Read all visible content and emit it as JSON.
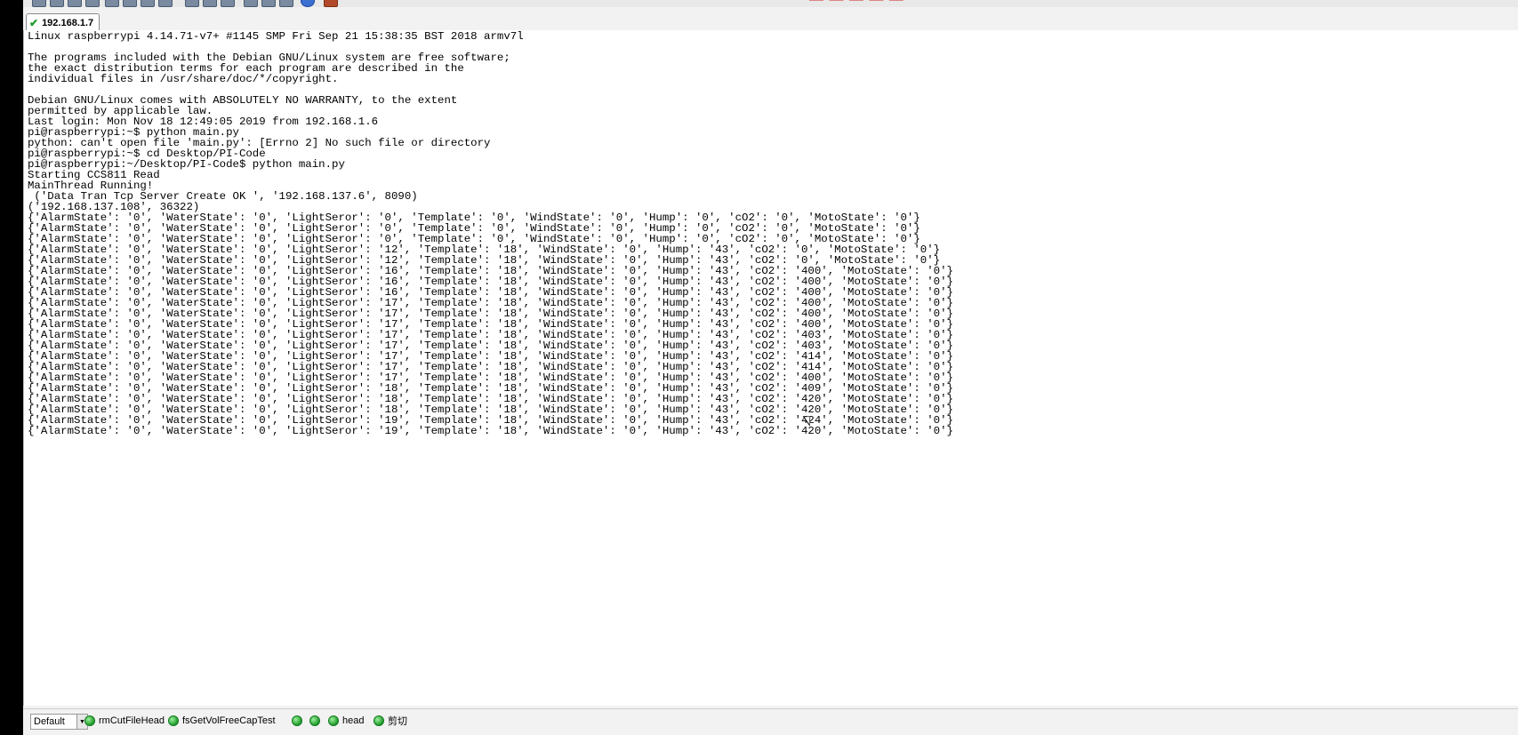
{
  "toolbar": {
    "title_fragment": "— — — — —"
  },
  "tab": {
    "label": "192.168.1.7",
    "icon": "check-icon"
  },
  "terminal": {
    "lines": [
      "Linux raspberrypi 4.14.71-v7+ #1145 SMP Fri Sep 21 15:38:35 BST 2018 armv7l",
      "",
      "The programs included with the Debian GNU/Linux system are free software;",
      "the exact distribution terms for each program are described in the",
      "individual files in /usr/share/doc/*/copyright.",
      "",
      "Debian GNU/Linux comes with ABSOLUTELY NO WARRANTY, to the extent",
      "permitted by applicable law.",
      "Last login: Mon Nov 18 12:49:05 2019 from 192.168.1.6",
      "pi@raspberrypi:~$ python main.py",
      "python: can't open file 'main.py': [Errno 2] No such file or directory",
      "pi@raspberrypi:~$ cd Desktop/PI-Code",
      "pi@raspberrypi:~/Desktop/PI-Code$ python main.py",
      "Starting CCS811 Read",
      "MainThread Running!",
      " ('Data Tran Tcp Server Create OK ', '192.168.137.6', 8090)",
      "('192.168.137.108', 36322)",
      "{'AlarmState': '0', 'WaterState': '0', 'LightSeror': '0', 'Template': '0', 'WindState': '0', 'Hump': '0', 'cO2': '0', 'MotoState': '0'}",
      "{'AlarmState': '0', 'WaterState': '0', 'LightSeror': '0', 'Template': '0', 'WindState': '0', 'Hump': '0', 'cO2': '0', 'MotoState': '0'}",
      "{'AlarmState': '0', 'WaterState': '0', 'LightSeror': '0', 'Template': '0', 'WindState': '0', 'Hump': '0', 'cO2': '0', 'MotoState': '0'}",
      "{'AlarmState': '0', 'WaterState': '0', 'LightSeror': '12', 'Template': '18', 'WindState': '0', 'Hump': '43', 'cO2': '0', 'MotoState': '0'}",
      "{'AlarmState': '0', 'WaterState': '0', 'LightSeror': '12', 'Template': '18', 'WindState': '0', 'Hump': '43', 'cO2': '0', 'MotoState': '0'}",
      "{'AlarmState': '0', 'WaterState': '0', 'LightSeror': '16', 'Template': '18', 'WindState': '0', 'Hump': '43', 'cO2': '400', 'MotoState': '0'}",
      "{'AlarmState': '0', 'WaterState': '0', 'LightSeror': '16', 'Template': '18', 'WindState': '0', 'Hump': '43', 'cO2': '400', 'MotoState': '0'}",
      "{'AlarmState': '0', 'WaterState': '0', 'LightSeror': '16', 'Template': '18', 'WindState': '0', 'Hump': '43', 'cO2': '400', 'MotoState': '0'}",
      "{'AlarmState': '0', 'WaterState': '0', 'LightSeror': '17', 'Template': '18', 'WindState': '0', 'Hump': '43', 'cO2': '400', 'MotoState': '0'}",
      "{'AlarmState': '0', 'WaterState': '0', 'LightSeror': '17', 'Template': '18', 'WindState': '0', 'Hump': '43', 'cO2': '400', 'MotoState': '0'}",
      "{'AlarmState': '0', 'WaterState': '0', 'LightSeror': '17', 'Template': '18', 'WindState': '0', 'Hump': '43', 'cO2': '400', 'MotoState': '0'}",
      "{'AlarmState': '0', 'WaterState': '0', 'LightSeror': '17', 'Template': '18', 'WindState': '0', 'Hump': '43', 'cO2': '403', 'MotoState': '0'}",
      "{'AlarmState': '0', 'WaterState': '0', 'LightSeror': '17', 'Template': '18', 'WindState': '0', 'Hump': '43', 'cO2': '403', 'MotoState': '0'}",
      "{'AlarmState': '0', 'WaterState': '0', 'LightSeror': '17', 'Template': '18', 'WindState': '0', 'Hump': '43', 'cO2': '414', 'MotoState': '0'}",
      "{'AlarmState': '0', 'WaterState': '0', 'LightSeror': '17', 'Template': '18', 'WindState': '0', 'Hump': '43', 'cO2': '414', 'MotoState': '0'}",
      "{'AlarmState': '0', 'WaterState': '0', 'LightSeror': '17', 'Template': '18', 'WindState': '0', 'Hump': '43', 'cO2': '400', 'MotoState': '0'}",
      "{'AlarmState': '0', 'WaterState': '0', 'LightSeror': '18', 'Template': '18', 'WindState': '0', 'Hump': '43', 'cO2': '409', 'MotoState': '0'}",
      "{'AlarmState': '0', 'WaterState': '0', 'LightSeror': '18', 'Template': '18', 'WindState': '0', 'Hump': '43', 'cO2': '420', 'MotoState': '0'}",
      "{'AlarmState': '0', 'WaterState': '0', 'LightSeror': '18', 'Template': '18', 'WindState': '0', 'Hump': '43', 'cO2': '420', 'MotoState': '0'}",
      "{'AlarmState': '0', 'WaterState': '0', 'LightSeror': '19', 'Template': '18', 'WindState': '0', 'Hump': '43', 'cO2': '424', 'MotoState': '0'}",
      "{'AlarmState': '0', 'WaterState': '0', 'LightSeror': '19', 'Template': '18', 'WindState': '0', 'Hump': '43', 'cO2': '420', 'MotoState': '0'}"
    ]
  },
  "bottombar": {
    "session_select": "Default",
    "buttons": [
      {
        "label": "rmCutFileHead"
      },
      {
        "label": "fsGetVolFreeCapTest"
      },
      {
        "label": ""
      },
      {
        "label": ""
      },
      {
        "label": "head"
      },
      {
        "label": "剪切"
      }
    ]
  },
  "colors": {
    "terminal_bg": "#ffffff",
    "terminal_fg": "#000000",
    "status_dot": "#1f9a2a",
    "title_accent": "#d02020"
  }
}
